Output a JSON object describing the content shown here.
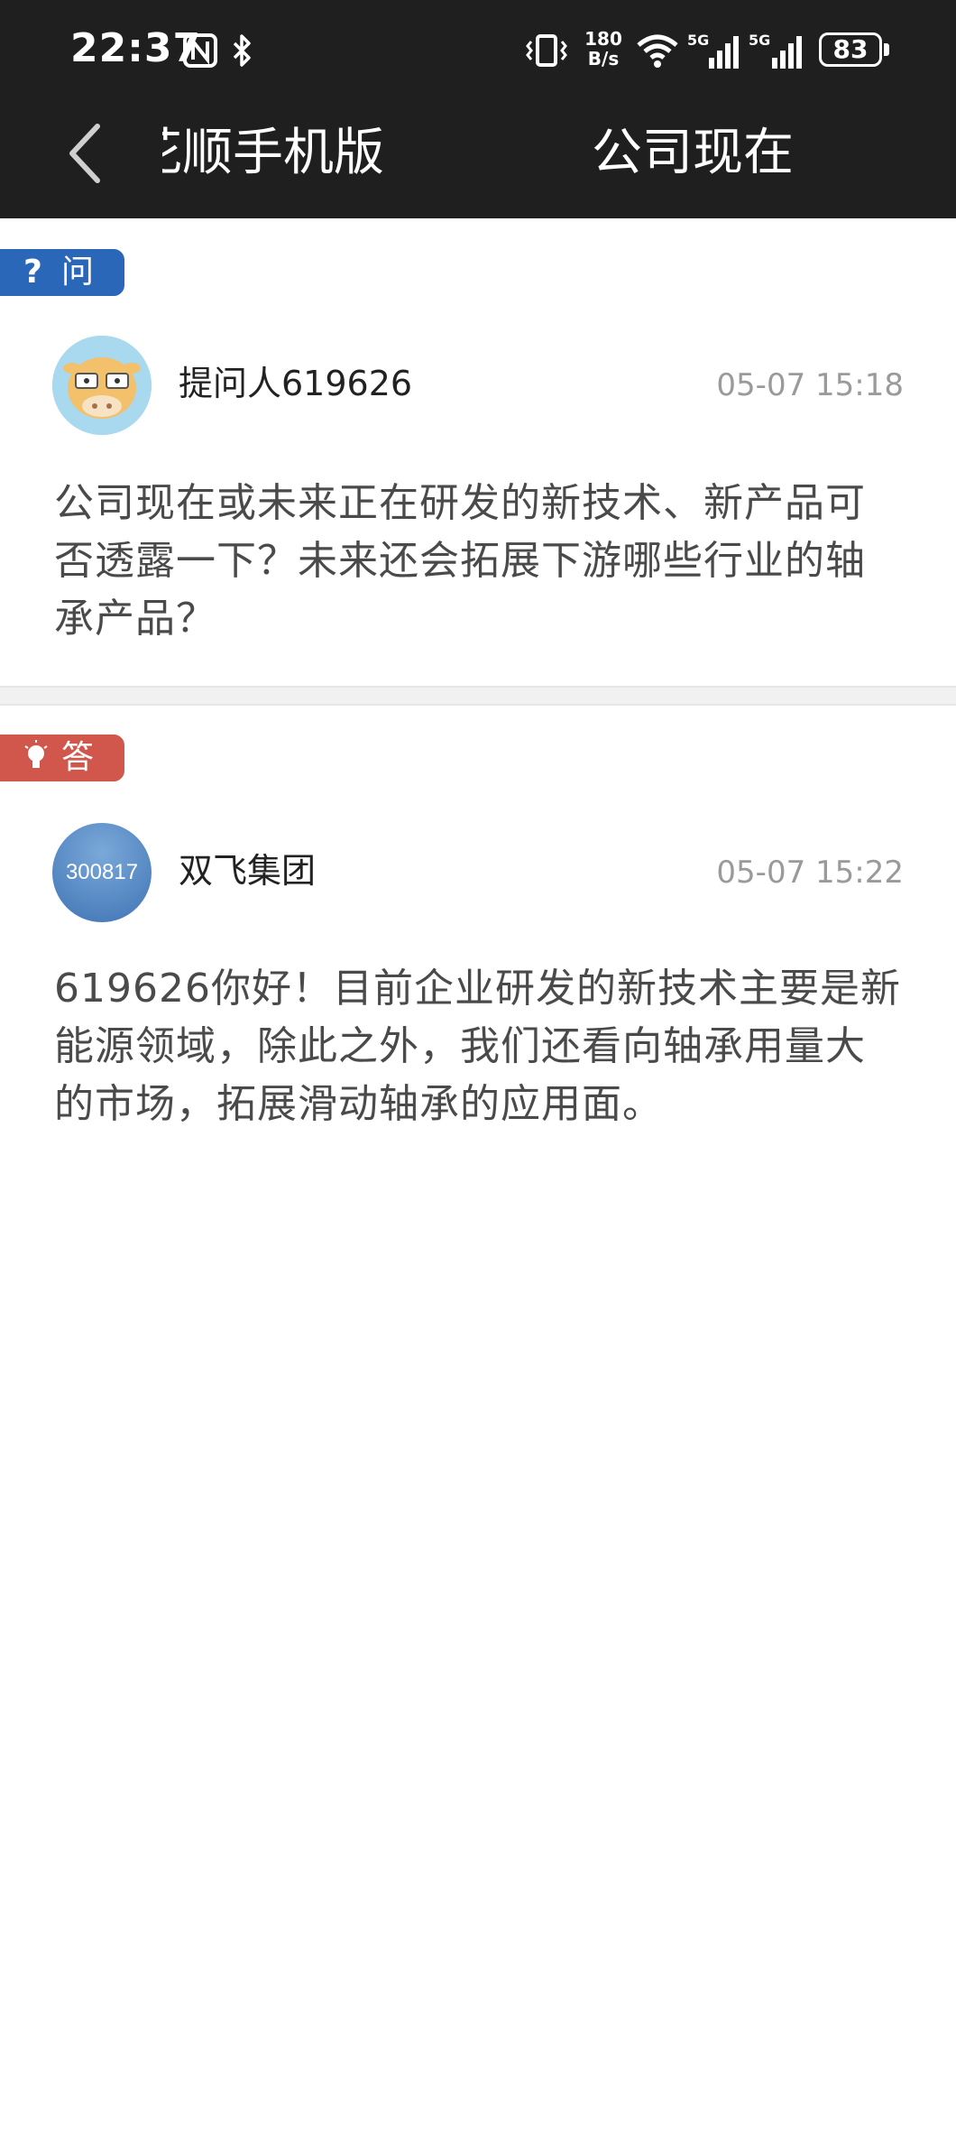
{
  "status_bar": {
    "time": "22:37",
    "net_speed_value": "180",
    "net_speed_unit": "B/s",
    "signal1_label": "5G",
    "signal2_label": "5G",
    "battery": "83",
    "icons": [
      "nfc-icon",
      "bluetooth-icon",
      "vibrate-icon",
      "wifi-icon",
      "signal-icon",
      "signal-icon",
      "battery-icon"
    ]
  },
  "nav": {
    "title_left": "同花顺手机版",
    "title_right": "公司现在"
  },
  "question": {
    "badge": "问",
    "user": "提问人619626",
    "time": "05-07 15:18",
    "content": "公司现在或未来正在研发的新技术、新产品可否透露一下？未来还会拓展下游哪些行业的轴承产品？"
  },
  "answer": {
    "badge": "答",
    "avatar_text": "300817",
    "user": "双飞集团",
    "time": "05-07 15:22",
    "content": "619626你好！目前企业研发的新技术主要是新能源领域，除此之外，我们还看向轴承用量大的市场，拓展滑动轴承的应用面。"
  },
  "colors": {
    "topbar": "#1f1f1f",
    "question_badge": "#2a67b8",
    "answer_badge": "#d1564b",
    "timestamp": "#9a9a9a"
  }
}
